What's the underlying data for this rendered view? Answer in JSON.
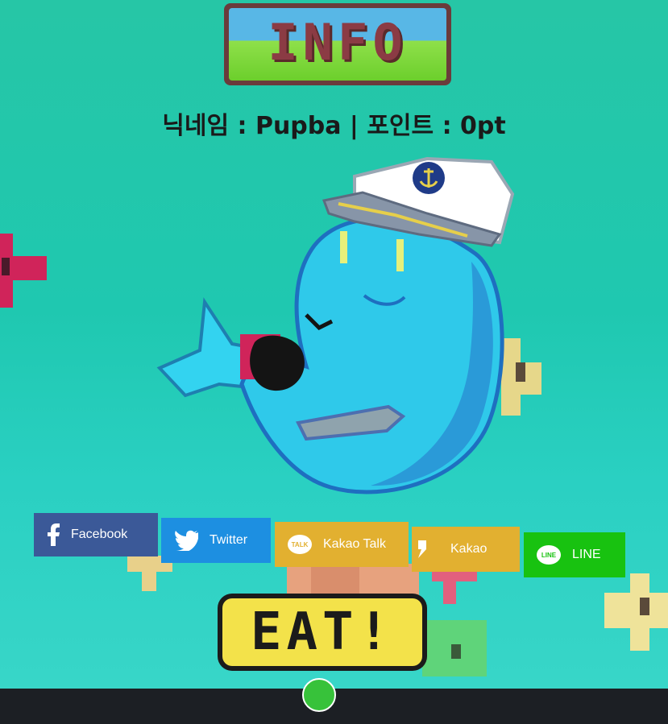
{
  "banner": {
    "title": "INFO"
  },
  "user": {
    "line": "닉네임 : Pupba | 포인트 : 0pt"
  },
  "share": {
    "facebook": {
      "label": "Facebook",
      "color": "#3b5998"
    },
    "twitter": {
      "label": "Twitter",
      "color": "#1d8fe1"
    },
    "kakao_talk": {
      "label": "Kakao Talk",
      "icon_text": "TALK",
      "color": "#e2b030"
    },
    "kakao": {
      "label": "Kakao",
      "color": "#e2b030"
    },
    "line": {
      "label": "LINE",
      "icon_text": "LINE",
      "color": "#18c210"
    }
  },
  "action": {
    "eat_label": "EAT!"
  },
  "character": {
    "icon": "whale-sailor-character"
  },
  "dock": {
    "icon": "green-app-icon"
  }
}
